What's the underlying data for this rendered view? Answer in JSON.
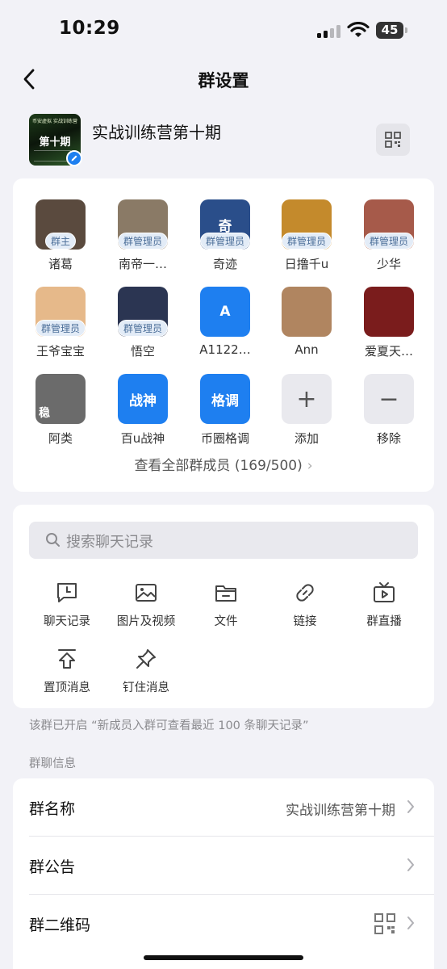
{
  "status": {
    "time": "10:29",
    "battery": "45",
    "icons": [
      "signal-icon",
      "wifi-icon",
      "battery-icon"
    ]
  },
  "nav": {
    "title": "群设置",
    "back_icon": "chevron-left-icon"
  },
  "group": {
    "name": "实战训练营第十期",
    "cover_top_text": "币安虚拟 实战训练营",
    "cover_main_text": "第十期",
    "qr_icon": "qr-code-icon",
    "edit_icon": "pencil-icon"
  },
  "members": [
    {
      "nickname": "诸葛",
      "role": "群主",
      "avatar_text": "",
      "color": "#5a4a3e"
    },
    {
      "nickname": "南帝一…",
      "role": "群管理员",
      "avatar_text": "",
      "color": "#8a7a66"
    },
    {
      "nickname": "奇迹",
      "role": "群管理员",
      "avatar_text": "奇",
      "color": "#2a4e8a"
    },
    {
      "nickname": "日撸千u",
      "role": "群管理员",
      "avatar_text": "",
      "color": "#c48a2c"
    },
    {
      "nickname": "少华",
      "role": "群管理员",
      "avatar_text": "",
      "color": "#a65a4a"
    },
    {
      "nickname": "王爷宝宝",
      "role": "群管理员",
      "avatar_text": "",
      "color": "#e6b98a"
    },
    {
      "nickname": "悟空",
      "role": "群管理员",
      "avatar_text": "",
      "color": "#2b3552"
    },
    {
      "nickname": "A1122…",
      "role": "",
      "avatar_text": "A",
      "color": "#1e7ff0"
    },
    {
      "nickname": "Ann",
      "role": "",
      "avatar_text": "",
      "color": "#b08560"
    },
    {
      "nickname": "爱夏天…",
      "role": "",
      "avatar_text": "",
      "color": "#7a1c1c"
    },
    {
      "nickname": "阿类",
      "role": "",
      "avatar_text": "稳",
      "color": "#6b6b6b"
    },
    {
      "nickname": "百u战神",
      "role": "",
      "avatar_text": "战神",
      "color": "#1e7ff0"
    },
    {
      "nickname": "币圈格调",
      "role": "",
      "avatar_text": "格调",
      "color": "#1e7ff0"
    }
  ],
  "member_actions": {
    "add_label": "添加",
    "add_symbol": "+",
    "remove_label": "移除",
    "remove_symbol": "−"
  },
  "view_all": {
    "text": "查看全部群成员 (169/500)",
    "chevron": "›"
  },
  "search": {
    "placeholder": "搜索聊天记录"
  },
  "tools": [
    {
      "label": "聊天记录",
      "icon": "chat-history-icon"
    },
    {
      "label": "图片及视频",
      "icon": "image-icon"
    },
    {
      "label": "文件",
      "icon": "folder-icon"
    },
    {
      "label": "链接",
      "icon": "link-icon"
    },
    {
      "label": "群直播",
      "icon": "live-tv-icon"
    },
    {
      "label": "置顶消息",
      "icon": "pin-top-icon"
    },
    {
      "label": "钉住消息",
      "icon": "pushpin-icon"
    }
  ],
  "notice": "该群已开启 “新成员入群可查看最近 100 条聊天记录”",
  "section_label": "群聊信息",
  "info_rows": [
    {
      "label": "群名称",
      "value": "实战训练营第十期"
    },
    {
      "label": "群公告",
      "value": ""
    },
    {
      "label": "群二维码",
      "value": ""
    }
  ]
}
